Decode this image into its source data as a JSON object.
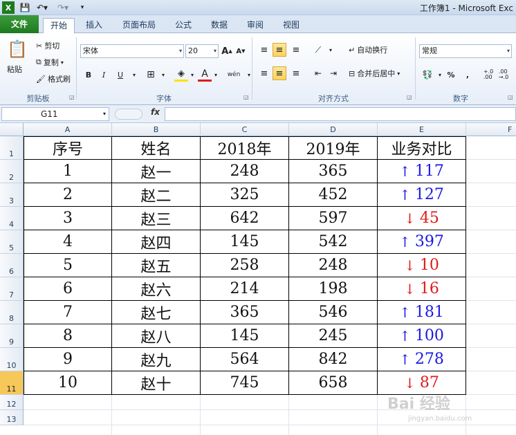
{
  "window": {
    "title": "工作簿1 - Microsoft Exc"
  },
  "tabs": {
    "file": "文件",
    "home": "开始",
    "insert": "插入",
    "page_layout": "页面布局",
    "formulas": "公式",
    "data": "数据",
    "review": "审阅",
    "view": "视图"
  },
  "clipboard": {
    "paste": "粘贴",
    "cut": "剪切",
    "copy": "复制",
    "format_painter": "格式刷",
    "label": "剪贴板"
  },
  "font": {
    "name": "宋体",
    "size": "20",
    "grow": "A",
    "shrink": "A",
    "bold": "B",
    "italic": "I",
    "underline": "U",
    "label": "字体",
    "phonetic": "wén"
  },
  "alignment": {
    "wrap": "自动换行",
    "merge": "合并后居中",
    "label": "对齐方式"
  },
  "number": {
    "format": "常规",
    "percent": "%",
    "comma": ",",
    "inc": "+.0\n.00",
    "dec": ".00\n→.0",
    "label": "数字"
  },
  "formula_bar": {
    "name_box": "G11",
    "fx": "fx"
  },
  "columns": [
    "A",
    "B",
    "C",
    "D",
    "E",
    "F"
  ],
  "rows": [
    "1",
    "2",
    "3",
    "4",
    "5",
    "6",
    "7",
    "8",
    "9",
    "10",
    "11",
    "12",
    "13"
  ],
  "table": {
    "headers": [
      "序号",
      "姓名",
      "2018年",
      "2019年",
      "业务对比"
    ],
    "rows": [
      {
        "no": "1",
        "name": "赵一",
        "y2018": "248",
        "y2019": "365",
        "dir": "↑",
        "diff": "117",
        "trend": "up"
      },
      {
        "no": "2",
        "name": "赵二",
        "y2018": "325",
        "y2019": "452",
        "dir": "↑",
        "diff": "127",
        "trend": "up"
      },
      {
        "no": "3",
        "name": "赵三",
        "y2018": "642",
        "y2019": "597",
        "dir": "↓",
        "diff": "45",
        "trend": "down"
      },
      {
        "no": "4",
        "name": "赵四",
        "y2018": "145",
        "y2019": "542",
        "dir": "↑",
        "diff": "397",
        "trend": "up"
      },
      {
        "no": "5",
        "name": "赵五",
        "y2018": "258",
        "y2019": "248",
        "dir": "↓",
        "diff": "10",
        "trend": "down"
      },
      {
        "no": "6",
        "name": "赵六",
        "y2018": "214",
        "y2019": "198",
        "dir": "↓",
        "diff": "16",
        "trend": "down"
      },
      {
        "no": "7",
        "name": "赵七",
        "y2018": "365",
        "y2019": "546",
        "dir": "↑",
        "diff": "181",
        "trend": "up"
      },
      {
        "no": "8",
        "name": "赵八",
        "y2018": "145",
        "y2019": "245",
        "dir": "↑",
        "diff": "100",
        "trend": "up"
      },
      {
        "no": "9",
        "name": "赵九",
        "y2018": "564",
        "y2019": "842",
        "dir": "↑",
        "diff": "278",
        "trend": "up"
      },
      {
        "no": "10",
        "name": "赵十",
        "y2018": "745",
        "y2019": "658",
        "dir": "↓",
        "diff": "87",
        "trend": "down"
      }
    ]
  },
  "watermark": {
    "text": "Bai 经验",
    "url": "jingyan.baidu.com"
  },
  "colors": {
    "up": "#1919e0",
    "down": "#e01919",
    "active_row": "#f6c759"
  }
}
